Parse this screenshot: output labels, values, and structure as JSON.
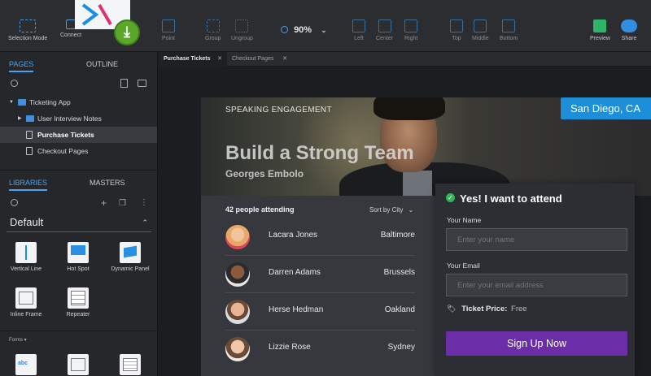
{
  "toolbar": {
    "selection_mode": "Selection Mode",
    "connect": "Connect",
    "point": "Point",
    "group": "Group",
    "ungroup": "Ungroup",
    "zoom": "90%",
    "align_left": "Left",
    "align_center": "Center",
    "align_right": "Right",
    "align_top": "Top",
    "align_middle": "Middle",
    "align_bottom": "Bottom",
    "preview": "Preview",
    "share": "Share"
  },
  "left_panel": {
    "pages_tab": "PAGES",
    "outline_tab": "OUTLINE",
    "tree": [
      {
        "label": "Ticketing App"
      },
      {
        "label": "User Interview Notes"
      },
      {
        "label": "Purchase Tickets"
      },
      {
        "label": "Checkout Pages"
      }
    ],
    "libraries_tab": "LIBRARIES",
    "masters_tab": "MASTERS",
    "library_select": "Default",
    "widgets": [
      {
        "label": "Vertical Line"
      },
      {
        "label": "Hot Spot"
      },
      {
        "label": "Dynamic Panel"
      },
      {
        "label": "Inline Frame"
      },
      {
        "label": "Repeater"
      }
    ],
    "forms_label": "Forms ▾"
  },
  "doc_tabs": [
    {
      "label": "Purchase Tickets"
    },
    {
      "label": "Checkout Pages"
    }
  ],
  "page": {
    "kicker": "SPEAKING ENGAGEMENT",
    "title": "Build a Strong Team",
    "speaker": "Georges Embolo",
    "city_badge": "San Diego, CA",
    "attending": "42 people attending",
    "sort": "Sort by City",
    "attendees": [
      {
        "name": "Lacara Jones",
        "city": "Baltimore"
      },
      {
        "name": "Darren Adams",
        "city": "Brussels"
      },
      {
        "name": "Herse Hedman",
        "city": "Oakland"
      },
      {
        "name": "Lizzie Rose",
        "city": "Sydney"
      }
    ],
    "form": {
      "title": "Yes! I want to attend",
      "name_label": "Your Name",
      "name_placeholder": "Enter your name",
      "email_label": "Your Email",
      "email_placeholder": "Enter your email address",
      "price_label": "Ticket Price:",
      "price_value": "Free",
      "submit": "Sign Up Now"
    }
  },
  "colors": {
    "accent": "#4aa3f0",
    "city_badge": "#1c8fd8",
    "submit": "#6b2ea8",
    "check": "#34b35a"
  }
}
